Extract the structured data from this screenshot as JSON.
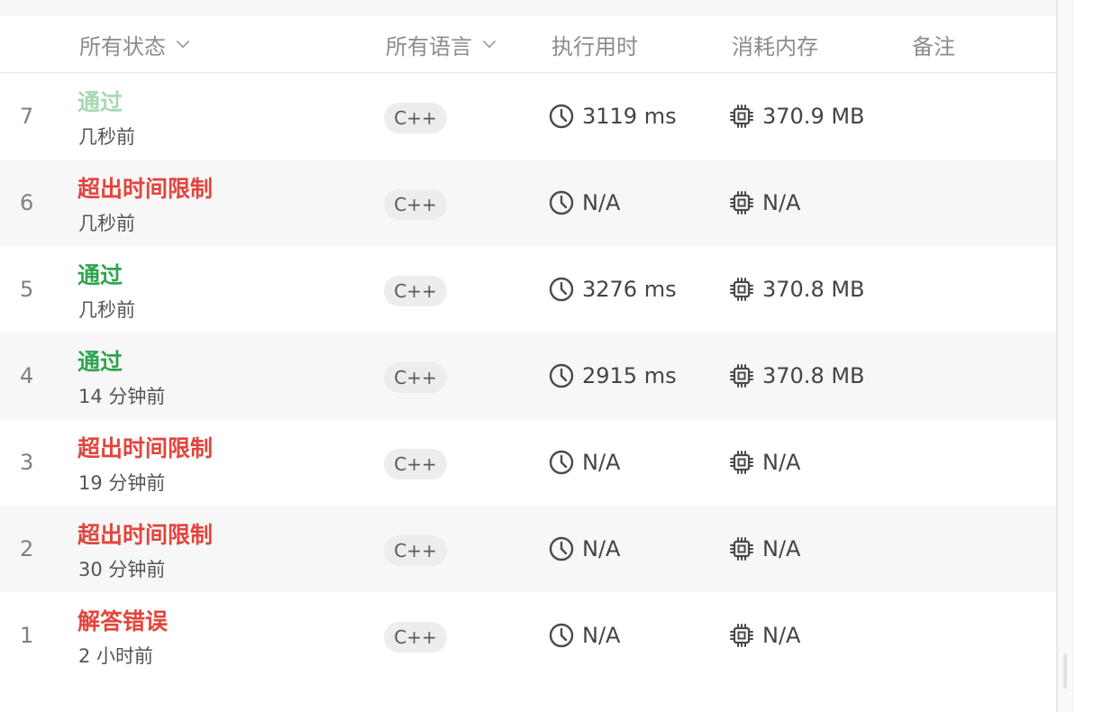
{
  "header": {
    "status_filter": "所有状态",
    "language_filter": "所有语言",
    "runtime": "执行用时",
    "memory": "消耗内存",
    "notes": "备注"
  },
  "submissions": [
    {
      "index": "7",
      "status": "通过",
      "status_type": "accepted-light",
      "time_ago": "几秒前",
      "language": "C++",
      "runtime": "3119 ms",
      "memory": "370.9 MB"
    },
    {
      "index": "6",
      "status": "超出时间限制",
      "status_type": "error",
      "time_ago": "几秒前",
      "language": "C++",
      "runtime": "N/A",
      "memory": "N/A"
    },
    {
      "index": "5",
      "status": "通过",
      "status_type": "accepted",
      "time_ago": "几秒前",
      "language": "C++",
      "runtime": "3276 ms",
      "memory": "370.8 MB"
    },
    {
      "index": "4",
      "status": "通过",
      "status_type": "accepted",
      "time_ago": "14 分钟前",
      "language": "C++",
      "runtime": "2915 ms",
      "memory": "370.8 MB"
    },
    {
      "index": "3",
      "status": "超出时间限制",
      "status_type": "error",
      "time_ago": "19 分钟前",
      "language": "C++",
      "runtime": "N/A",
      "memory": "N/A"
    },
    {
      "index": "2",
      "status": "超出时间限制",
      "status_type": "error",
      "time_ago": "30 分钟前",
      "language": "C++",
      "runtime": "N/A",
      "memory": "N/A"
    },
    {
      "index": "1",
      "status": "解答错误",
      "status_type": "error",
      "time_ago": "2 小时前",
      "language": "C++",
      "runtime": "N/A",
      "memory": "N/A"
    }
  ],
  "icons": {
    "runtime_icon": "clock-icon",
    "memory_icon": "chip-icon",
    "filter_icon": "chevron-down-icon"
  },
  "colors": {
    "accepted": "#2ea44f",
    "accepted_light": "#a7d9b3",
    "error": "#e2453c",
    "alt_row": "#f7f7f7"
  }
}
